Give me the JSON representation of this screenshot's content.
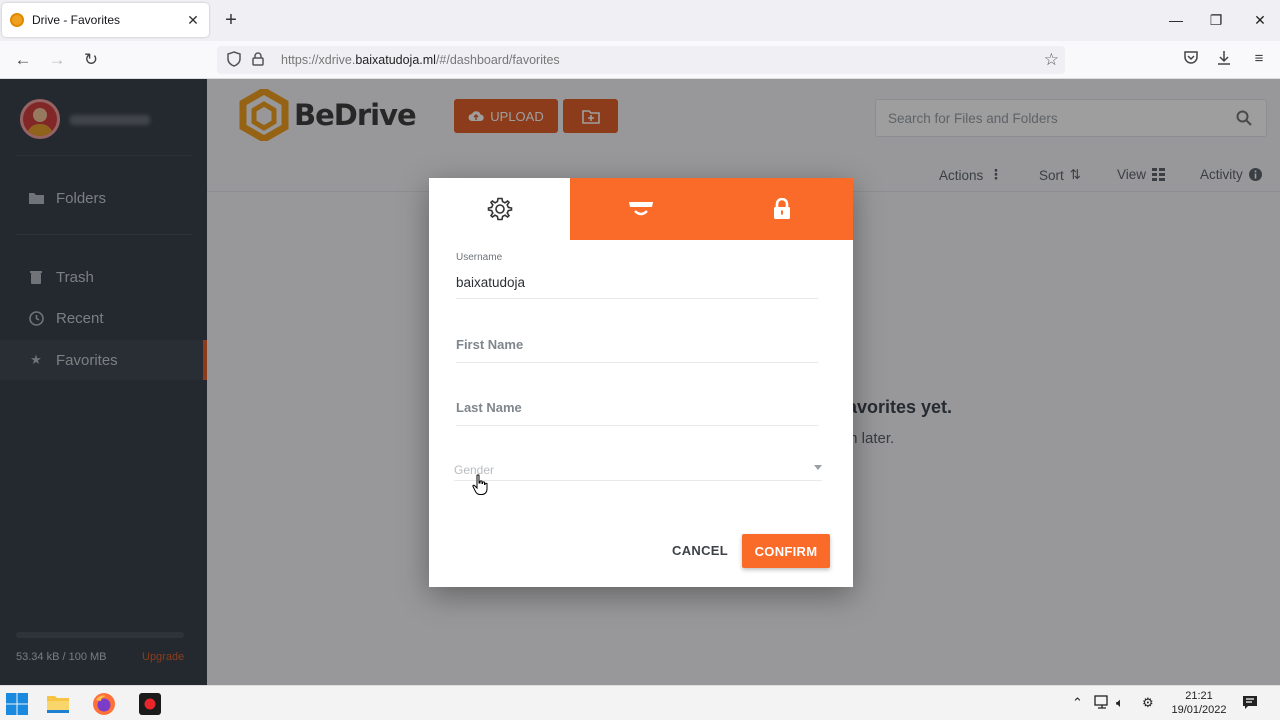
{
  "browser": {
    "tab_title": "Drive - Favorites",
    "url_prefix": "https://xdrive.",
    "url_domain": "baixatudoja.ml",
    "url_path": "/#/dashboard/favorites"
  },
  "app": {
    "logo_text": "BeDrive",
    "upload_label": "UPLOAD",
    "search_placeholder": "Search for Files and Folders",
    "toolbar": {
      "actions": "Actions",
      "sort": "Sort",
      "view": "View",
      "activity": "Activity"
    },
    "sidebar": {
      "items": [
        {
          "label": "Folders",
          "icon": "folder-icon"
        },
        {
          "label": "Trash",
          "icon": "trash-icon"
        },
        {
          "label": "Recent",
          "icon": "clock-icon"
        },
        {
          "label": "Favorites",
          "icon": "star-icon"
        }
      ],
      "storage": "53.34 kB / 100 MB",
      "upgrade": "Upgrade"
    },
    "empty_state": {
      "title": "avorites yet.",
      "subtitle": "m later."
    },
    "accent": "#e2612a"
  },
  "modal": {
    "tabs": [
      "gear-icon",
      "mask-icon",
      "lock-icon"
    ],
    "username_label": "Username",
    "username_value": "baixatudoja",
    "first_name_placeholder": "First Name",
    "last_name_placeholder": "Last Name",
    "gender_placeholder": "Gender",
    "cancel": "CANCEL",
    "confirm": "CONFIRM",
    "accent": "#fa6b2a"
  },
  "taskbar": {
    "time": "21:21",
    "date": "19/01/2022"
  }
}
